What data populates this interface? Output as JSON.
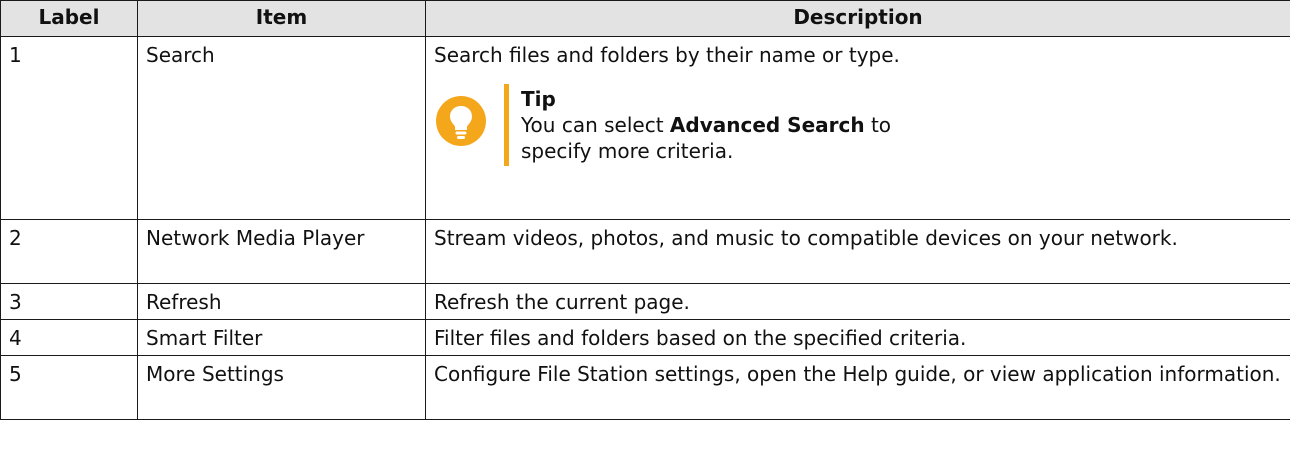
{
  "table": {
    "headers": [
      "Label",
      "Item",
      "Description"
    ],
    "rows": [
      {
        "label": "1",
        "item": "Search",
        "description": "Search files and folders by their name or type.",
        "tip": {
          "title": "Tip",
          "text_before": "You can select ",
          "text_bold": "Advanced Search",
          "text_after": " to specify more criteria."
        }
      },
      {
        "label": "2",
        "item": "Network Media Player",
        "description": "Stream videos, photos, and music to compatible devices on your network."
      },
      {
        "label": "3",
        "item": "Refresh",
        "description": "Refresh the current page."
      },
      {
        "label": "4",
        "item": "Smart Filter",
        "description": "Filter files and folders based on the specified criteria."
      },
      {
        "label": "5",
        "item": "More Settings",
        "description": "Configure File Station settings, open the Help guide, or view application information."
      }
    ]
  },
  "colors": {
    "header_bg": "#e3e3e3",
    "tip_accent": "#f5a71c",
    "border": "#1a1a1a"
  },
  "icons": {
    "tip": "lightbulb-icon"
  }
}
